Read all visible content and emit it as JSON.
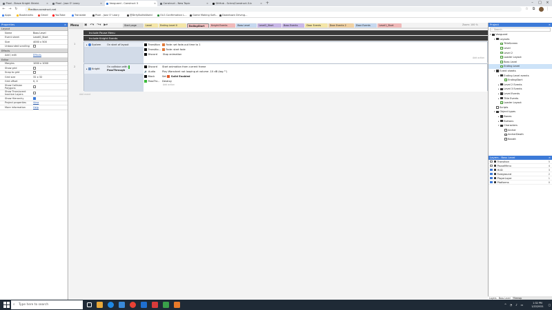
{
  "browser": {
    "tabs": [
      {
        "label": "Pixel - Brave Knight Shield.",
        "active": false
      },
      {
        "label": "Pixel - Jazz O' Leary",
        "active": false
      },
      {
        "label": "Vanguard - Construct 3",
        "active": true
      },
      {
        "label": "Construct - New Topic",
        "active": false
      },
      {
        "label": "GitHub - Scirra/Construct-3-b",
        "active": false
      }
    ],
    "url": "editor.construct.net",
    "bookmarks": [
      "Apps",
      "Bookmarks",
      "Gmail",
      "YouTube",
      "Translate",
      "Pixel - Jazz O' Leary",
      "@DirtyBuiltsWorld",
      "OLG Confirmation L...",
      "Game Making Soft...",
      "Downtown Driving..."
    ]
  },
  "c3": {
    "menu_label": "Menu",
    "zoom": "Zoom: 100 %"
  },
  "properties": {
    "title": "Properties",
    "sections": [
      {
        "name": "Layout",
        "rows": [
          {
            "key": "Name",
            "value": "Boss Level"
          },
          {
            "key": "Event sheet",
            "value": "Level0_Start"
          },
          {
            "key": "Size",
            "value": "4000 x 500"
          },
          {
            "key": "Unbounded scrolling",
            "value": "",
            "checkbox": false
          }
        ]
      },
      {
        "name": "Effects",
        "rows": [
          {
            "key": "Add / edit",
            "value": "Effects",
            "link": true
          }
        ]
      },
      {
        "name": "Editor",
        "rows": [
          {
            "key": "Margins",
            "value": "1000 x 1000"
          },
          {
            "key": "Show grid",
            "value": "",
            "checkbox": false
          },
          {
            "key": "Snap to grid",
            "value": "",
            "checkbox": false
          },
          {
            "key": "Grid size",
            "value": "32 x 32"
          },
          {
            "key": "Grid offset",
            "value": "0, 0"
          },
          {
            "key": "Show Collision Polygons",
            "value": "",
            "checkbox": false
          },
          {
            "key": "Show Translucent Inactive Layers",
            "value": "",
            "checkbox": false
          },
          {
            "key": "Show Hierarchy",
            "value": "",
            "checkbox": true
          }
        ]
      },
      {
        "name": "",
        "plain": true,
        "rows": [
          {
            "key": "Project properties",
            "value": "View",
            "link": true
          },
          {
            "key": "More information",
            "value": "Help",
            "link": true
          }
        ]
      }
    ]
  },
  "event_tabs": [
    {
      "label": "Start page",
      "color": "#d6d6d6"
    },
    {
      "label": "Level",
      "color": "#f4e6a8"
    },
    {
      "label": "Ending Level 0",
      "color": "#f4e6a8"
    },
    {
      "label": "EndingStart",
      "color": "#f7c3c3",
      "active": true
    },
    {
      "label": "Knight Events",
      "color": "#f0b9b9"
    },
    {
      "label": "Boss Level",
      "color": "#c6d8ef"
    },
    {
      "label": "Level2_Start",
      "color": "#c9b8e8"
    },
    {
      "label": "Boss Events",
      "color": "#c9b8e8"
    },
    {
      "label": "Door Events",
      "color": "#f4e6a8"
    },
    {
      "label": "Door Events 2",
      "color": "#f0d1a3"
    },
    {
      "label": "Door Events",
      "color": "#c6d8ef"
    },
    {
      "label": "Level1_Start",
      "color": "#f0b9b9"
    }
  ],
  "events": {
    "includes": [
      "Include Pause Menu",
      "Include Knight Events"
    ],
    "event1": {
      "number": "1",
      "condition_object": "System",
      "condition_text": "On start of layout",
      "actions": [
        {
          "object": "Transition",
          "text": "Fade: set fade-out time to 1"
        },
        {
          "object": "Transitio...",
          "text": "Fade: start fade"
        },
        {
          "object": "Discord",
          "text": "Stop animation"
        }
      ]
    },
    "event2": {
      "number": "2",
      "condition_object": "Knight",
      "condition_text": "On collision with",
      "condition_target": "PassThrough",
      "actions": [
        {
          "object": "Discord",
          "text": "Start animation from current frame"
        },
        {
          "object": "Audio",
          "text": "Play Warsdsmt not looping at volume -10 dB (tag \"\")"
        },
        {
          "object": "Block",
          "text": "Set",
          "extra": "Solid Enabled"
        },
        {
          "object": "PassThr...",
          "text": "Destroy"
        }
      ]
    },
    "add_action": "Add action",
    "add_event": "Add event"
  },
  "project": {
    "title": "Project",
    "search_placeholder": "Search",
    "tree": [
      {
        "label": "Vanguard",
        "level": 0,
        "type": "folder",
        "twisty": "▾"
      },
      {
        "label": "Layouts",
        "level": 1,
        "type": "folder",
        "twisty": "▾"
      },
      {
        "label": "TitleScreen",
        "level": 2,
        "type": "layout"
      },
      {
        "label": "Level",
        "level": 2,
        "type": "layout"
      },
      {
        "label": "Level 2",
        "level": 2,
        "type": "layout"
      },
      {
        "label": "Loader Layout",
        "level": 2,
        "type": "layout"
      },
      {
        "label": "Boss Level",
        "level": 2,
        "type": "layout"
      },
      {
        "label": "Ending Level",
        "level": 2,
        "type": "layout",
        "selected": true
      },
      {
        "label": "Event sheets",
        "level": 1,
        "type": "folder",
        "twisty": "▾"
      },
      {
        "label": "Ending Level events",
        "level": 2,
        "type": "folder",
        "twisty": "▾"
      },
      {
        "label": "EndingStart",
        "level": 3,
        "type": "event"
      },
      {
        "label": "Level 2 Events",
        "level": 2,
        "type": "folder",
        "twisty": "▸"
      },
      {
        "label": "Level 3 Events",
        "level": 2,
        "type": "folder",
        "twisty": "▸"
      },
      {
        "label": "Level Events",
        "level": 2,
        "type": "folder",
        "twisty": "▸"
      },
      {
        "label": "Title Events",
        "level": 2,
        "type": "folder",
        "twisty": "▸"
      },
      {
        "label": "Loader Layout",
        "level": 2,
        "type": "event"
      },
      {
        "label": "Scripts",
        "level": 1,
        "type": "object"
      },
      {
        "label": "Object types",
        "level": 1,
        "type": "folder",
        "twisty": "▾"
      },
      {
        "label": "Bones",
        "level": 2,
        "type": "folder",
        "twisty": "▸"
      },
      {
        "label": "Buttons",
        "level": 2,
        "type": "folder",
        "twisty": "▸"
      },
      {
        "label": "Characters",
        "level": 2,
        "type": "folder",
        "twisty": "▾"
      },
      {
        "label": "Archer",
        "level": 3,
        "type": "object"
      },
      {
        "label": "ArcherDeath",
        "level": 3,
        "type": "object"
      },
      {
        "label": "Bandit",
        "level": 3,
        "type": "object"
      }
    ]
  },
  "layers": {
    "title": "Layers - Boss Level",
    "items": [
      {
        "label": "Transition",
        "number": "5",
        "visible": false
      },
      {
        "label": "PauseMenu",
        "number": "4",
        "visible": false
      },
      {
        "label": "HUD",
        "number": "3",
        "visible": true
      },
      {
        "label": "Foreground",
        "number": "2",
        "visible": true
      },
      {
        "label": "PlayerLayer",
        "number": "1",
        "visible": true
      },
      {
        "label": "Platforms",
        "number": "0",
        "visible": true
      }
    ],
    "bottom_tabs": [
      "Layers - Boss Level",
      "Tilemap"
    ]
  },
  "taskbar": {
    "search_placeholder": "Type here to search",
    "time": "1:32 PM",
    "date": "1/22/2021"
  },
  "colors": {
    "accent": "#3c7ad8",
    "include_bar": "#3a3a3a",
    "taskbar": "#1f2a36"
  }
}
